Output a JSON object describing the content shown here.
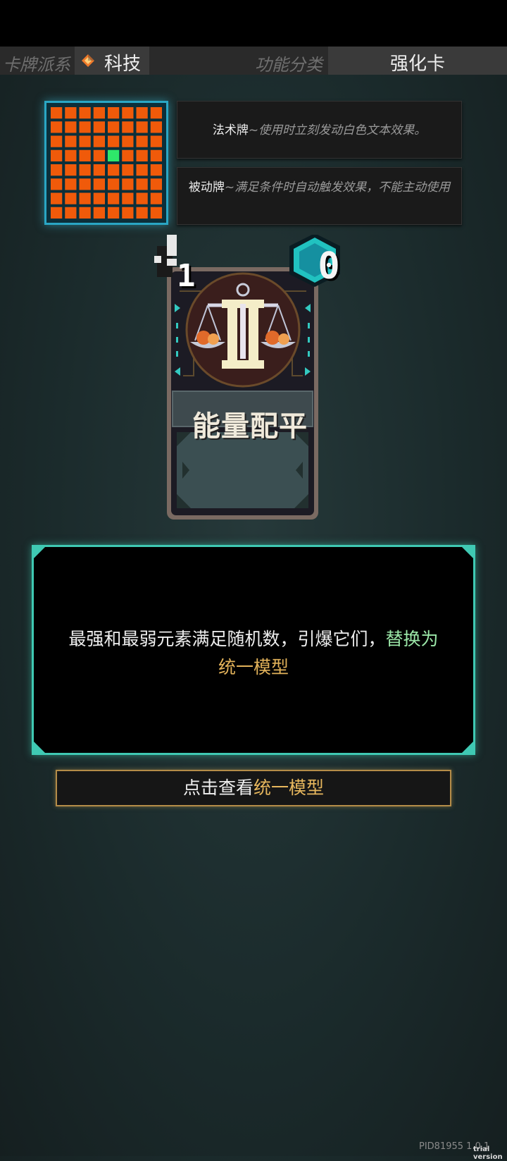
{
  "header": {
    "faction_label": "卡牌派系",
    "faction_value": "科技",
    "function_label": "功能分类",
    "function_value": "强化卡"
  },
  "legend": {
    "spell_name": "法术牌",
    "spell_desc": "~使用时立刻发动白色文本效果。",
    "passive_name": "被动牌",
    "passive_desc": "~满足条件时自动触发效果，不能主动使用"
  },
  "grid": {
    "rows": 8,
    "cols": 8,
    "highlight_row": 3,
    "highlight_col": 4,
    "cell_color": "#f05a0a",
    "highlight_color": "#2ee86a"
  },
  "card": {
    "cost": "1",
    "energy": "0",
    "name": "能量配平",
    "emblem": "balance-scale-icon"
  },
  "description": {
    "part1": "最强和最弱元素满足随机数，引爆它们，",
    "part2": "替换为",
    "part3": "统一模型"
  },
  "view_button": {
    "prefix": "点击查看",
    "highlight": "统一模型"
  },
  "footer": {
    "version": "PID81955 1.0.1",
    "trial": "trial version"
  }
}
